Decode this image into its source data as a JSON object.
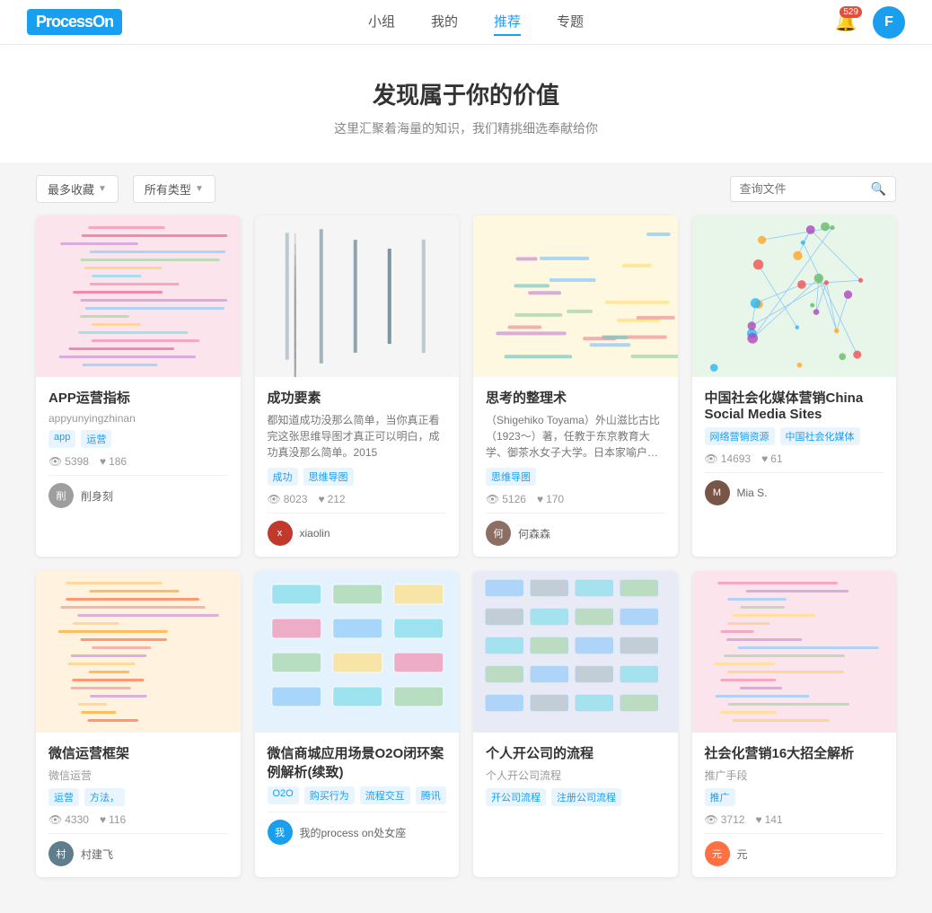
{
  "header": {
    "logo_text": "Process",
    "logo_on": "On",
    "nav": [
      {
        "label": "小组",
        "active": false
      },
      {
        "label": "我的",
        "active": false
      },
      {
        "label": "推荐",
        "active": true
      },
      {
        "label": "专题",
        "active": false
      }
    ],
    "notification_count": "529",
    "avatar_letter": "F"
  },
  "hero": {
    "title": "发现属于你的价值",
    "subtitle": "这里汇聚着海量的知识，我们精挑细选奉献给你"
  },
  "filters": {
    "sort_label": "最多收藏",
    "type_label": "所有类型",
    "search_placeholder": "查询文件"
  },
  "cards": [
    {
      "title": "APP运营指标",
      "author": "appyunyingzhinan",
      "desc": "",
      "tags": [
        "app",
        "运营"
      ],
      "views": "5398",
      "likes": "186",
      "footer_name": "削身刻",
      "footer_avatar_color": "#9e9e9e",
      "footer_avatar_letter": "削",
      "thumb_type": "mindmap_pink"
    },
    {
      "title": "成功要素",
      "author": "",
      "desc": "都知道成功没那么简单，当你真正看完这张思维导图才真正可以明白，成功真没那么简单。2015",
      "tags": [
        "成功",
        "思维导图"
      ],
      "views": "8023",
      "likes": "212",
      "footer_name": "xiaolin",
      "footer_avatar_color": "#c0392b",
      "footer_avatar_letter": "x",
      "thumb_type": "mindmap_vertical"
    },
    {
      "title": "思考的整理术",
      "author": "",
      "desc": "（Shigehiko Toyama）外山滋比古比（1923～）著，任教于东京教育大学、御茶水女子大学。日本家喻户晓的语言..",
      "tags": [
        "思维导图"
      ],
      "views": "5126",
      "likes": "170",
      "footer_name": "何森森",
      "footer_avatar_color": "#8d6e63",
      "footer_avatar_letter": "何",
      "thumb_type": "mindmap_colorful"
    },
    {
      "title": "中国社会化媒体营销China Social Media Sites",
      "author": "",
      "desc": "",
      "tags": [
        "网络营销资源",
        "中国社会化媒体"
      ],
      "views": "14693",
      "likes": "61",
      "footer_name": "Mia S.",
      "footer_avatar_color": "#795548",
      "footer_avatar_letter": "M",
      "thumb_type": "network_map"
    },
    {
      "title": "微信运营框架",
      "author": "微信运营",
      "desc": "",
      "tags": [
        "运营",
        "方法，"
      ],
      "views": "4330",
      "likes": "116",
      "footer_name": "村建飞",
      "footer_avatar_color": "#607d8b",
      "footer_avatar_letter": "村",
      "thumb_type": "mindmap_orange"
    },
    {
      "title": "微信商城应用场景O2O闭环案例解析(续致)",
      "author": "",
      "desc": "",
      "tags": [
        "O2O",
        "购买行为",
        "流程交互",
        "腾讯"
      ],
      "views": "",
      "likes": "",
      "footer_name": "我的process on处女座",
      "footer_avatar_color": "#1a9ef0",
      "footer_avatar_letter": "我",
      "thumb_type": "flowchart_complex"
    },
    {
      "title": "个人开公司的流程",
      "author": "个人开公司流程",
      "desc": "",
      "tags": [
        "开公司流程",
        "注册公司流程"
      ],
      "views": "",
      "likes": "",
      "footer_name": "",
      "footer_avatar_color": "#78909c",
      "footer_avatar_letter": "",
      "thumb_type": "flowchart_blue"
    },
    {
      "title": "社会化营销16大招全解析",
      "author": "推广手段",
      "desc": "",
      "tags": [
        "推广"
      ],
      "views": "3712",
      "likes": "141",
      "footer_name": "元",
      "footer_avatar_color": "#ff7043",
      "footer_avatar_letter": "元",
      "thumb_type": "mindmap_pastel"
    }
  ]
}
